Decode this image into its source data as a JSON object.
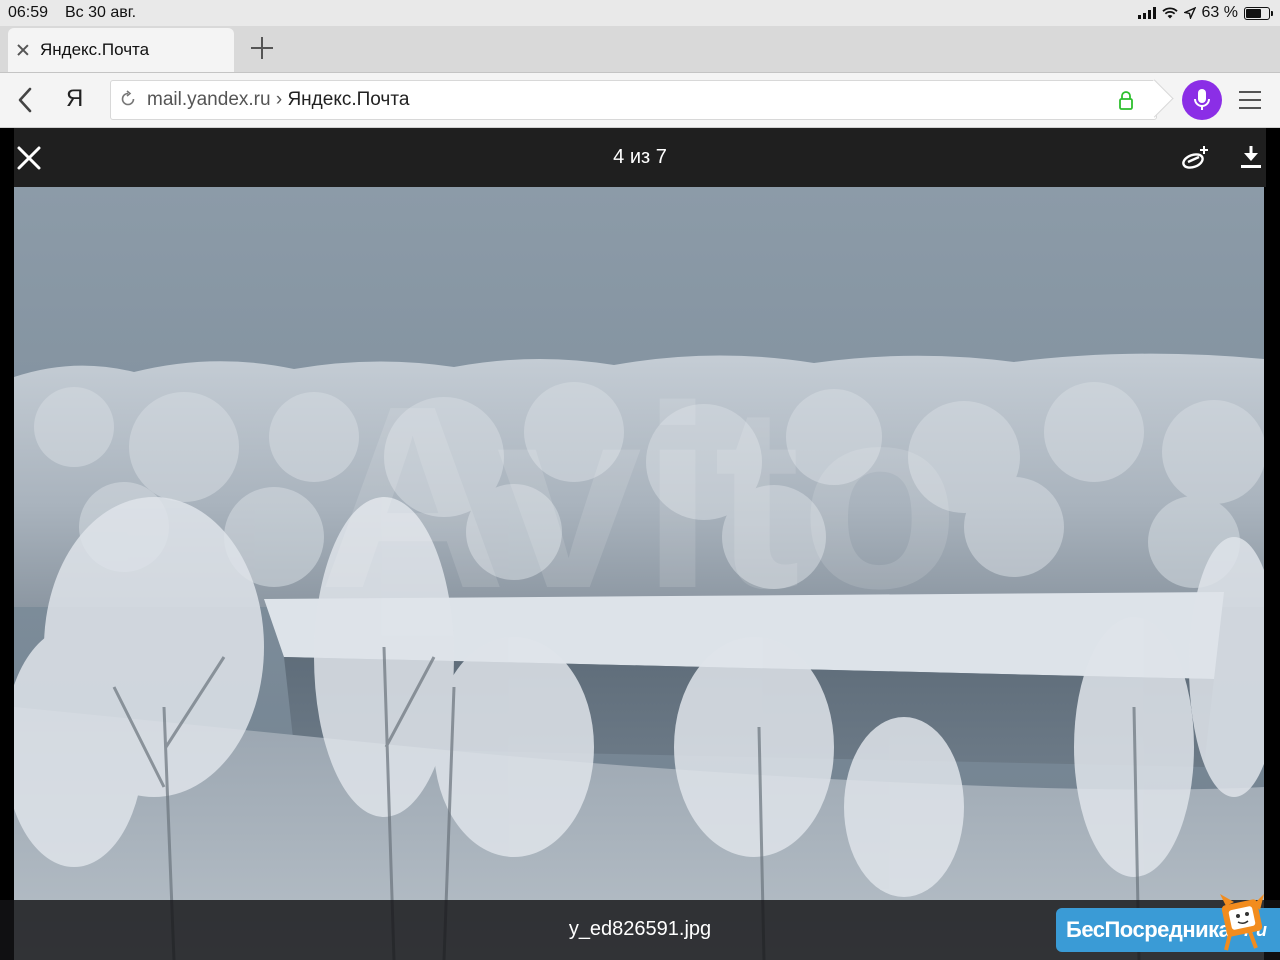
{
  "status_bar": {
    "time": "06:59",
    "date": "Вс 30 авг.",
    "battery": "63 %",
    "battery_level": 0.63
  },
  "browser": {
    "tab_title": "Яндекс.Почта",
    "ya_logo": "Я",
    "url_domain": "mail.yandex.ru",
    "url_separator": "›",
    "url_page": "Яндекс.Почта"
  },
  "viewer": {
    "counter": "4 из 7",
    "filename": "y_ed826591.jpg"
  },
  "watermarks": {
    "photo_watermark": "Avito",
    "badge_text": "БесПосредника",
    "badge_tld": ".ru"
  },
  "colors": {
    "mic_button": "#8b2ee6",
    "lock_green": "#2dbf2d",
    "badge_blue": "#3a9bd6",
    "viewer_bar": "#1f1f1f"
  },
  "icons": [
    "close-icon",
    "plus-icon",
    "back-icon",
    "reload-icon",
    "lock-icon",
    "mic-icon",
    "menu-icon",
    "disk-icon",
    "download-icon"
  ]
}
